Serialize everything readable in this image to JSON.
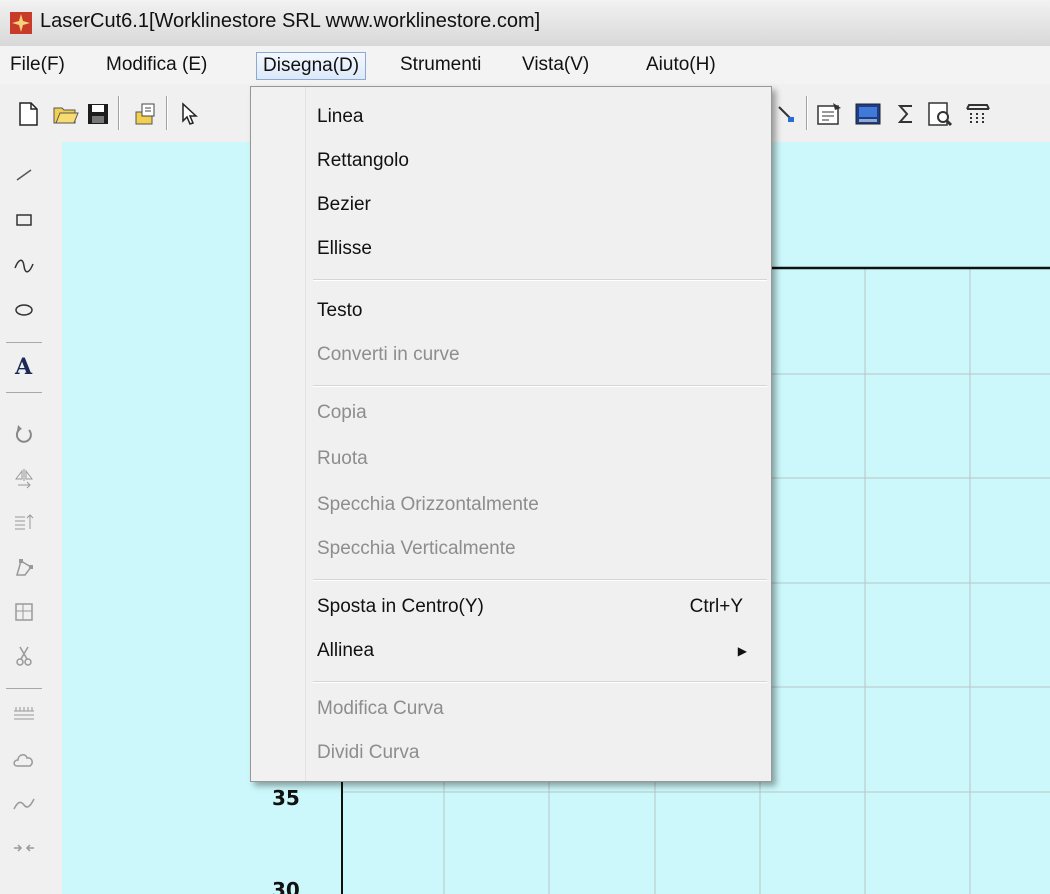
{
  "window": {
    "title": "LaserCut6.1[Worklinestore SRL www.worklinestore.com]"
  },
  "menubar": {
    "items": [
      {
        "label": "File(F)"
      },
      {
        "label": "Modifica (E)"
      },
      {
        "label": "Disegna(D)",
        "active": true
      },
      {
        "label": "Strumenti"
      },
      {
        "label": "Vista(V)"
      },
      {
        "label": "Aiuto(H)"
      }
    ]
  },
  "dropdown": {
    "items": [
      {
        "label": "Linea",
        "enabled": true
      },
      {
        "label": "Rettangolo",
        "enabled": true
      },
      {
        "label": "Bezier",
        "enabled": true
      },
      {
        "label": "Ellisse",
        "enabled": true
      },
      {
        "label": "Testo",
        "enabled": true
      },
      {
        "label": "Converti in curve",
        "enabled": false
      },
      {
        "label": "Copia",
        "enabled": false
      },
      {
        "label": "Ruota",
        "enabled": false
      },
      {
        "label": "Specchia Orizzontalmente",
        "enabled": false
      },
      {
        "label": "Specchia Verticalmente",
        "enabled": false
      },
      {
        "label": "Sposta in Centro(Y)",
        "enabled": true,
        "shortcut": "Ctrl+Y"
      },
      {
        "label": "Allinea",
        "enabled": true,
        "submenu": true
      },
      {
        "label": "Modifica Curva",
        "enabled": false
      },
      {
        "label": "Dividi Curva",
        "enabled": false
      }
    ]
  },
  "toolbar": {
    "left_icons": [
      "new-file-icon",
      "open-folder-icon",
      "save-icon",
      "import-icon",
      "select-pointer-icon"
    ],
    "right_icons": [
      "node-edit-icon",
      "properties-icon",
      "display-icon",
      "sigma-icon",
      "print-preview-icon",
      "output-icon"
    ]
  },
  "left_tools": [
    "line-tool-icon",
    "rectangle-tool-icon",
    "bezier-tool-icon",
    "ellipse-tool-icon",
    "text-tool-icon",
    "rotate-tool-icon",
    "mirror-horizontal-icon",
    "mirror-vertical-icon",
    "node-tool-icon",
    "crop-icon",
    "scissors-icon",
    "array-icon",
    "cloud-icon",
    "smooth-curve-icon",
    "join-icon"
  ],
  "canvas": {
    "background": "#ccf8fb",
    "ruler_labels": [
      "35",
      "30"
    ]
  },
  "colors": {
    "menu_disabled": "#8d8d8d",
    "menu_highlight_border": "#8ba9d2"
  }
}
